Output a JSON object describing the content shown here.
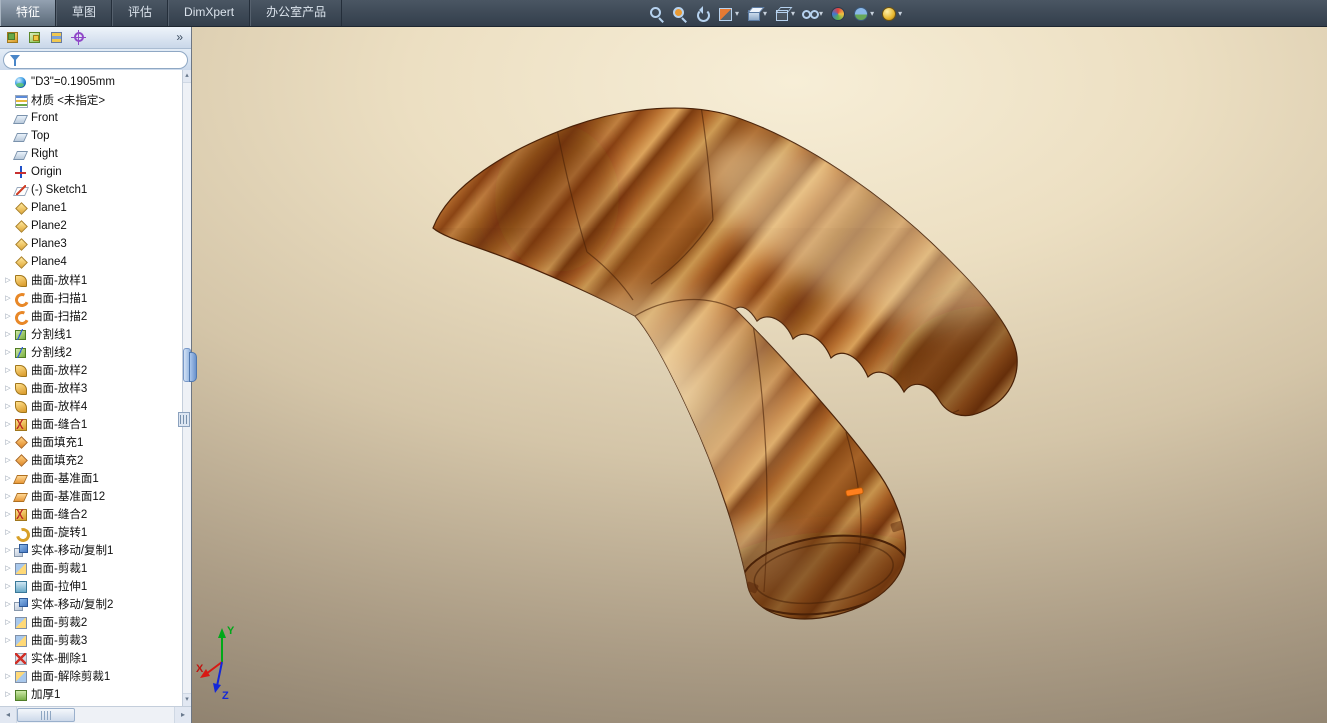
{
  "menu_tabs": [
    {
      "label": "特征",
      "active": true
    },
    {
      "label": "草图",
      "active": false
    },
    {
      "label": "评估",
      "active": false
    },
    {
      "label": "DimXpert",
      "active": false
    },
    {
      "label": "办公室产品",
      "active": false
    }
  ],
  "view_toolbar": [
    {
      "name": "zoom-fit",
      "dropdown": false
    },
    {
      "name": "zoom-area",
      "dropdown": false
    },
    {
      "name": "previous-view",
      "dropdown": false
    },
    {
      "name": "section-view",
      "dropdown": true
    },
    {
      "name": "view-orientation",
      "dropdown": true
    },
    {
      "name": "display-style",
      "dropdown": true
    },
    {
      "name": "hide-show",
      "dropdown": true
    },
    {
      "name": "edit-appearance",
      "dropdown": false
    },
    {
      "name": "apply-scene",
      "dropdown": true
    },
    {
      "name": "view-settings",
      "dropdown": true
    }
  ],
  "panel": {
    "tabs": [
      {
        "name": "feature-manager-design-tree",
        "cls": "feature-tree"
      },
      {
        "name": "property-manager",
        "cls": "property-manager"
      },
      {
        "name": "configuration-manager",
        "cls": "configuration-manager"
      },
      {
        "name": "dimxpert-manager",
        "cls": "dimxpert-manager"
      }
    ],
    "more_label": "»",
    "filter_placeholder": ""
  },
  "tree": {
    "items": [
      {
        "label": "\"D3\"=0.1905mm",
        "icon": "dimension-sphere",
        "expand": false
      },
      {
        "label": "材质 <未指定>",
        "icon": "material",
        "expand": false
      },
      {
        "label": "Front",
        "icon": "ref-plane",
        "expand": false
      },
      {
        "label": "Top",
        "icon": "ref-plane",
        "expand": false
      },
      {
        "label": "Right",
        "icon": "ref-plane",
        "expand": false
      },
      {
        "label": "Origin",
        "icon": "origin",
        "expand": false
      },
      {
        "label": "(-) Sketch1",
        "icon": "sketch",
        "expand": false
      },
      {
        "label": "Plane1",
        "icon": "plane",
        "expand": false
      },
      {
        "label": "Plane2",
        "icon": "plane",
        "expand": false
      },
      {
        "label": "Plane3",
        "icon": "plane",
        "expand": false
      },
      {
        "label": "Plane4",
        "icon": "plane",
        "expand": false
      },
      {
        "label": "曲面-放样1",
        "icon": "surface-loft",
        "expand": true
      },
      {
        "label": "曲面-扫描1",
        "icon": "surface-sweep",
        "expand": true
      },
      {
        "label": "曲面-扫描2",
        "icon": "surface-sweep",
        "expand": true
      },
      {
        "label": "分割线1",
        "icon": "split-line",
        "expand": true
      },
      {
        "label": "分割线2",
        "icon": "split-line",
        "expand": true
      },
      {
        "label": "曲面-放样2",
        "icon": "surface-loft",
        "expand": true
      },
      {
        "label": "曲面-放样3",
        "icon": "surface-loft",
        "expand": true
      },
      {
        "label": "曲面-放样4",
        "icon": "surface-loft",
        "expand": true
      },
      {
        "label": "曲面-缝合1",
        "icon": "surface-knit",
        "expand": true
      },
      {
        "label": "曲面填充1",
        "icon": "surface-fill",
        "expand": true
      },
      {
        "label": "曲面填充2",
        "icon": "surface-fill",
        "expand": true
      },
      {
        "label": "曲面-基准面1",
        "icon": "surface-plane",
        "expand": true
      },
      {
        "label": "曲面-基准面12",
        "icon": "surface-plane",
        "expand": true
      },
      {
        "label": "曲面-缝合2",
        "icon": "surface-knit",
        "expand": true
      },
      {
        "label": "曲面-旋转1",
        "icon": "surface-revolve",
        "expand": true
      },
      {
        "label": "实体-移动/复制1",
        "icon": "move-copy",
        "expand": true
      },
      {
        "label": "曲面-剪裁1",
        "icon": "surface-trim",
        "expand": true
      },
      {
        "label": "曲面-拉伸1",
        "icon": "surface-extrude",
        "expand": true
      },
      {
        "label": "实体-移动/复制2",
        "icon": "move-copy",
        "expand": true
      },
      {
        "label": "曲面-剪裁2",
        "icon": "surface-trim",
        "expand": true
      },
      {
        "label": "曲面-剪裁3",
        "icon": "surface-trim",
        "expand": true
      },
      {
        "label": "实体-删除1",
        "icon": "delete-body",
        "expand": false
      },
      {
        "label": "曲面-解除剪裁1",
        "icon": "surface-untrim",
        "expand": true
      },
      {
        "label": "加厚1",
        "icon": "thicken",
        "expand": true
      }
    ],
    "twisty_glyph": "▷"
  },
  "scrollbar": {
    "up": "▴",
    "down": "▾",
    "left": "◂",
    "right": "▸"
  },
  "triad": {
    "x": "X",
    "y": "Y",
    "z": "Z"
  },
  "colors": {
    "menubar": "#3c4856",
    "tab_active": "#7e8c9c",
    "panel_header": "#d5e1f0",
    "viewport_light": "#f7eed7",
    "viewport_dark": "#8b7e6c",
    "wood_dark": "#7a3a12",
    "wood_mid": "#b87030",
    "wood_light": "#dca45c",
    "selection_marker": "#ff7f1e"
  }
}
